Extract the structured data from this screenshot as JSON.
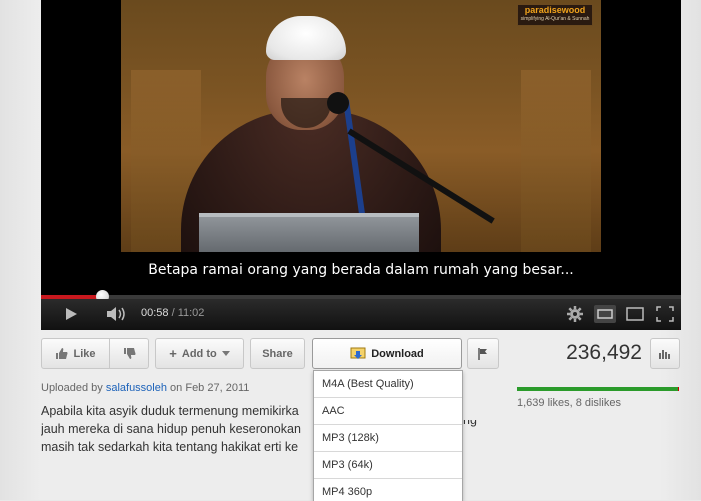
{
  "player": {
    "subtitle": "Betapa ramai orang yang berada dalam rumah yang besar...",
    "watermark_title": "paradisewood",
    "watermark_sub": "simplifying Al-Qur'an & Sunnah",
    "current_time": "00:58",
    "separator": " / ",
    "duration": "11:02",
    "progress_played_fraction": 0.097,
    "progress_loaded_fraction": 0.097,
    "icons": [
      "play-icon",
      "volume-icon",
      "settings-icon",
      "small-player-icon",
      "large-player-icon",
      "fullscreen-icon"
    ],
    "accent_color": "#c8181e"
  },
  "actions": {
    "like_label": "Like",
    "add_to_label": "Add to",
    "share_label": "Share",
    "download_label": "Download",
    "views": "236,492"
  },
  "uploader": {
    "prefix": "Uploaded by ",
    "name": "salafussoleh",
    "on": " on ",
    "date": "Feb 27, 2011"
  },
  "ratings": {
    "summary": "1,639 likes, 8 dislikes",
    "like_fraction": 0.995,
    "like_color": "#2b9b2b",
    "dislike_color": "#cc0000"
  },
  "description": {
    "lines": [
      "Apabila kita asyik duduk termenung memikirka",
      "jauh mereka di sana hidup penuh keseronokan",
      "masih tak sedarkah kita tentang hakikat erti ke"
    ],
    "line_right": "ng"
  },
  "download_menu": {
    "items": [
      "M4A (Best Quality)",
      "AAC",
      "MP3 (128k)",
      "MP3 (64k)",
      "MP4 360p"
    ]
  }
}
